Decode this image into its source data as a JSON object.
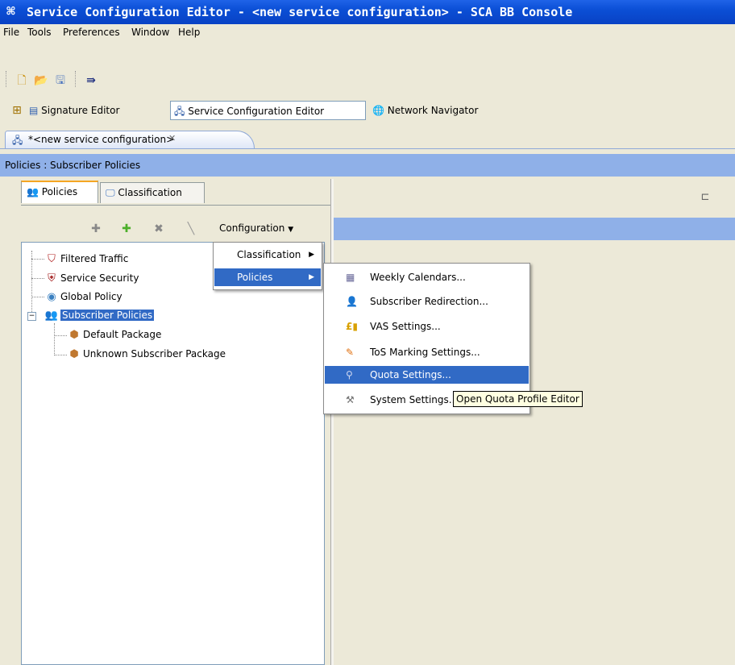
{
  "window": {
    "title": "Service Configuration Editor - <new service configuration> - SCA BB Console",
    "icon": "app-logo-icon"
  },
  "menubar": [
    "File",
    "Tools",
    "Preferences",
    "Window",
    "Help"
  ],
  "toolbar": {
    "icons": [
      "new-file-icon",
      "open-folder-icon",
      "save-icon",
      "forward-arrow-icon"
    ]
  },
  "perspectives": [
    {
      "label": "Signature Editor",
      "icon": "document-icon"
    },
    {
      "label": "Service Configuration Editor",
      "icon": "editor-icon",
      "active": true
    },
    {
      "label": "Network Navigator",
      "icon": "globe-icon"
    }
  ],
  "editor_tab": {
    "label": "*<new service configuration>",
    "close_icon": "close-icon"
  },
  "breadcrumb": "Policies : Subscriber Policies",
  "left_tabs": [
    {
      "label": "Policies",
      "active": true
    },
    {
      "label": "Classification",
      "active": false
    }
  ],
  "left_toolbar": {
    "configuration_label": "Configuration"
  },
  "tree": [
    {
      "label": "Filtered Traffic",
      "icon": "filter-icon"
    },
    {
      "label": "Service Security",
      "icon": "shield-icon"
    },
    {
      "label": "Global Policy",
      "icon": "global-policy-icon"
    },
    {
      "label": "Subscriber Policies",
      "icon": "users-icon",
      "selected": true
    },
    {
      "label": "Default Package",
      "icon": "package-icon"
    },
    {
      "label": "Unknown Subscriber Package",
      "icon": "package-icon"
    }
  ],
  "config_menu": [
    {
      "label": "Classification",
      "has_submenu": true
    },
    {
      "label": "Policies",
      "has_submenu": true,
      "highlighted": true
    }
  ],
  "policies_submenu": [
    {
      "label": "Weekly Calendars...",
      "icon": "calendar-icon"
    },
    {
      "label": "Subscriber Redirection...",
      "icon": "redirect-icon"
    },
    {
      "label": "VAS Settings...",
      "icon": "vas-icon"
    },
    {
      "label": "ToS Marking Settings...",
      "icon": "marker-icon"
    },
    {
      "label": "Quota Settings...",
      "icon": "quota-icon",
      "highlighted": true
    },
    {
      "label": "System Settings...",
      "icon": "tools-icon"
    }
  ],
  "tooltip": "Open Quota Profile Editor"
}
